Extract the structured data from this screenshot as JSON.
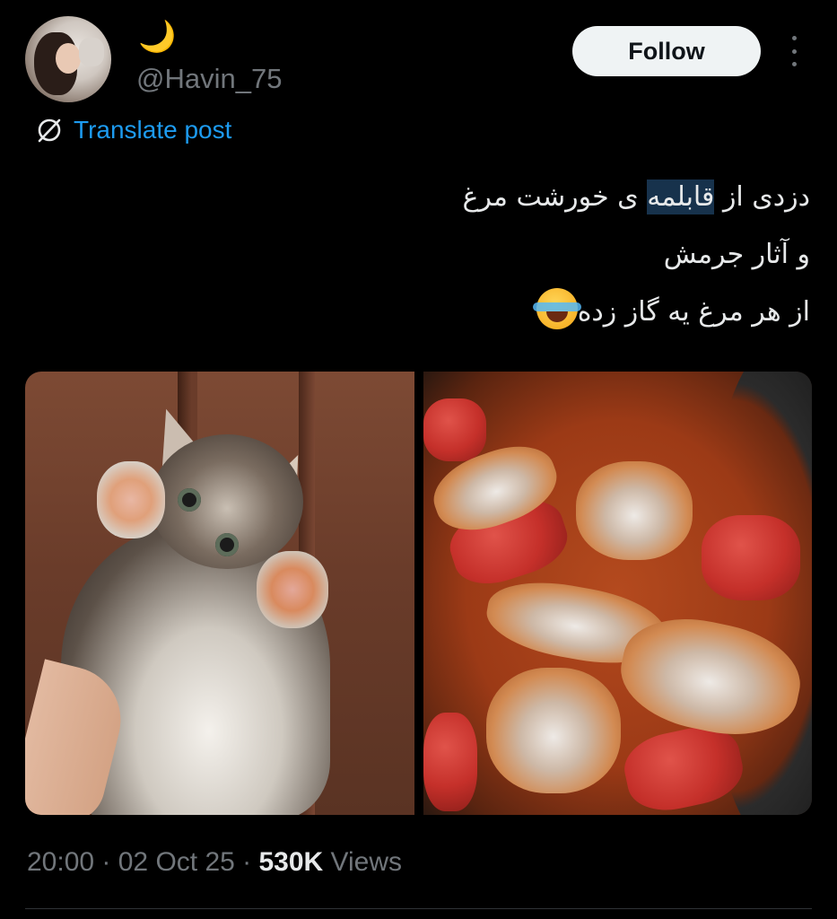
{
  "user": {
    "handle": "@Havin_75",
    "name_emoji": "🌙"
  },
  "actions": {
    "follow_label": "Follow",
    "more_icon": "more-vertical-icon"
  },
  "translate": {
    "label": "Translate post",
    "icon": "translate-globe-icon"
  },
  "post": {
    "line1_start": "دزدی از ",
    "line1_highlight": "قابلمه",
    "line1_end": " ی خورشت مرغ",
    "line2": "و آثار جرمش",
    "line3": "از هر مرغ یه گاز زده",
    "line3_emoji": "face-with-tears-of-joy"
  },
  "media": [
    {
      "subject": "kitten-photo"
    },
    {
      "subject": "chicken-stew-photo"
    }
  ],
  "meta": {
    "time": "20:00",
    "sep1": " · ",
    "date": "02 Oct 25",
    "sep2": " · ",
    "views_count": "530K",
    "views_label": " Views"
  },
  "colors": {
    "background": "#000000",
    "text": "#e7e9ea",
    "secondary": "#71767b",
    "accent": "#1d9bf0",
    "highlight": "#17324c"
  }
}
